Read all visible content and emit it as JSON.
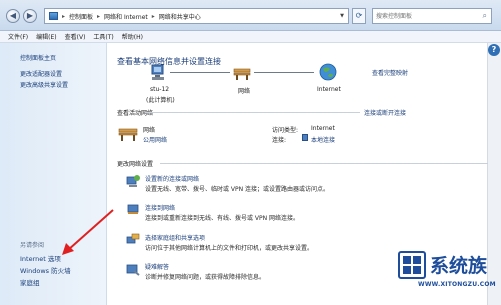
{
  "window": {
    "breadcrumbs": [
      "控制面板",
      "网络和 Internet",
      "网络和共享中心"
    ],
    "search_placeholder": "搜索控制面板"
  },
  "menu": [
    "文件(F)",
    "编辑(E)",
    "查看(V)",
    "工具(T)",
    "帮助(H)"
  ],
  "sidebar": {
    "items": [
      {
        "label": "控制面板主页"
      },
      {
        "label": "更改适配器设置"
      },
      {
        "label": "更改高级共享设置"
      }
    ],
    "see_also_heading": "另请参阅",
    "see_also": [
      {
        "label": "Internet 选项"
      },
      {
        "label": "Windows 防火墙"
      },
      {
        "label": "家庭组"
      }
    ]
  },
  "main": {
    "title": "查看基本网络信息并设置连接",
    "full_map_link": "查看完整映射",
    "map": {
      "computer_line1": "stu-12",
      "computer_line2": "(此计算机)",
      "network_label": "网络",
      "internet_label": "Internet"
    },
    "active_networks": {
      "heading": "查看活动网络",
      "connect_link": "连接或断开连接",
      "network_name": "网络",
      "network_type": "公用网络",
      "access_type_label": "访问类型:",
      "access_type_value": "Internet",
      "connections_label": "连接:",
      "connections_value": "本地连接"
    },
    "change_settings": {
      "heading": "更改网络设置",
      "items": [
        {
          "title": "设置新的连接或网络",
          "desc": "设置无线、宽带、拨号、临时或 VPN 连接；或设置路由器或访问点。"
        },
        {
          "title": "连接到网络",
          "desc": "连接到或重新连接到无线、有线、拨号或 VPN 网络连接。"
        },
        {
          "title": "选择家庭组和共享选项",
          "desc": "访问位于其他网络计算机上的文件和打印机，或更改共享设置。"
        },
        {
          "title": "疑难解答",
          "desc": "诊断并修复网络问题，或获得故障排除信息。"
        }
      ]
    }
  },
  "watermark": {
    "brand": "系统族",
    "url": "WWW.XITONGZU.COM"
  },
  "colors": {
    "link": "#1b3f7a",
    "sidebar_bg": "#ddeaf7",
    "arrow": "#e02020",
    "watermark": "#1d4d9b"
  }
}
